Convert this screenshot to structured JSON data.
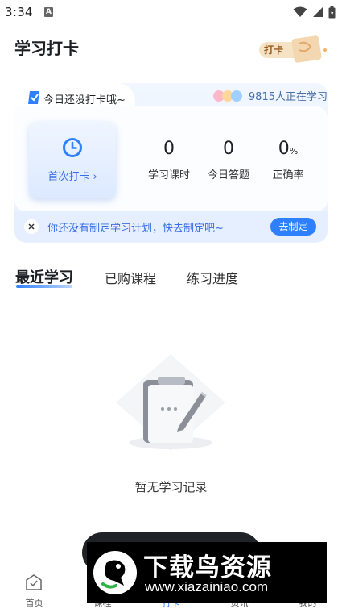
{
  "status_bar": {
    "time": "3:34",
    "notification_glyph": "A"
  },
  "header": {
    "title": "学习打卡",
    "badge_label": "打卡"
  },
  "checkin_card": {
    "tab_text": "今日还没打卡哦~",
    "learners_text": "9815人正在学习",
    "first_checkin_label": "首次打卡 ›",
    "stats": [
      {
        "value": "0",
        "unit": "",
        "label": "学习课时"
      },
      {
        "value": "0",
        "unit": "",
        "label": "今日答题"
      },
      {
        "value": "0",
        "unit": "%",
        "label": "正确率"
      }
    ],
    "plan_text": "你还没有制定学习计划，快去制定吧~",
    "plan_button": "去制定"
  },
  "tabs": [
    {
      "label": "最近学习",
      "active": true
    },
    {
      "label": "已购课程",
      "active": false
    },
    {
      "label": "练习进度",
      "active": false
    }
  ],
  "empty_state": {
    "text": "暂无学习记录"
  },
  "bottom_nav": [
    {
      "label": "首页",
      "icon": "home-icon"
    },
    {
      "label": "课程",
      "icon": "course-icon"
    },
    {
      "label": "打卡",
      "icon": "checkin-icon"
    },
    {
      "label": "资讯",
      "icon": "news-icon"
    },
    {
      "label": "我的",
      "icon": "profile-icon"
    }
  ],
  "watermark": {
    "title": "下载鸟资源",
    "url": "www.xiazainiao.com"
  },
  "colors": {
    "accent": "#2f80ff",
    "accent_text": "#3a6ee8",
    "card_bg": "#eaf2ff"
  }
}
